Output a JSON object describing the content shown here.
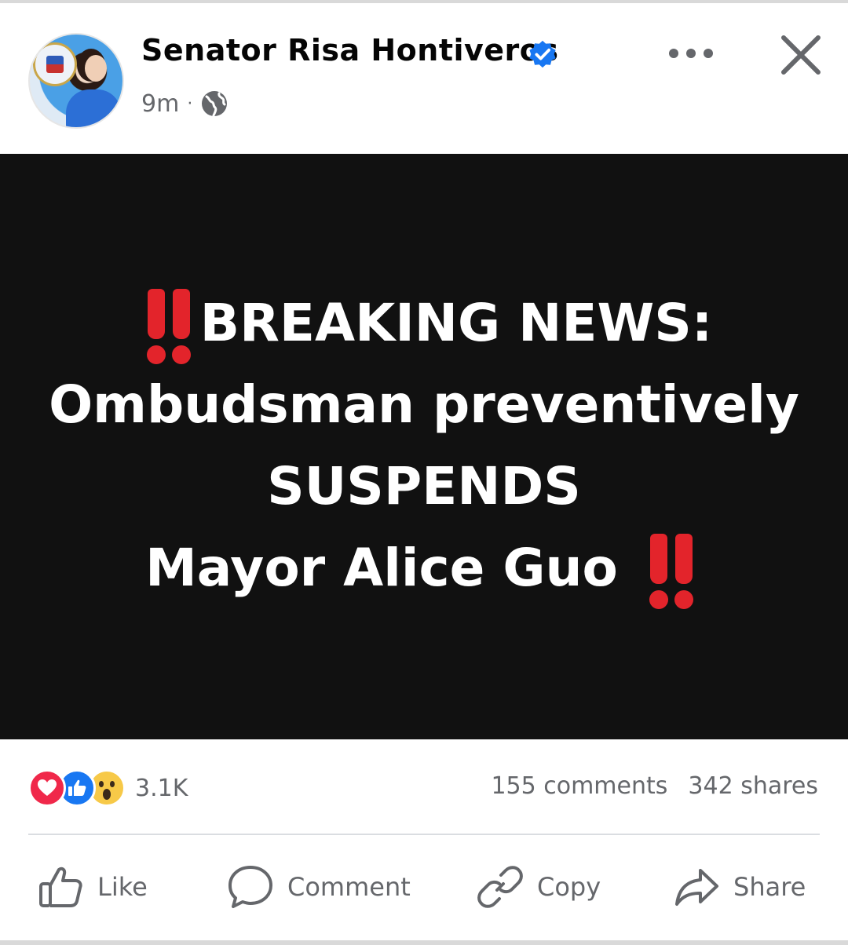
{
  "post": {
    "author": "Senator Risa Hontiveros",
    "time": "9m",
    "separator": "·"
  },
  "media": {
    "line1": "BREAKING NEWS:",
    "line2": "Ombudsman preventively",
    "line3": "SUSPENDS",
    "line4": "Mayor Alice Guo"
  },
  "engagement": {
    "reaction_count": "3.1K",
    "comments": "155 comments",
    "shares": "342 shares"
  },
  "actions": {
    "like": "Like",
    "comment": "Comment",
    "copy": "Copy",
    "share": "Share"
  },
  "colors": {
    "verified": "#1877f2",
    "media_background": "#111111",
    "alert_red": "#e3242b",
    "secondary_text": "#65676b"
  }
}
